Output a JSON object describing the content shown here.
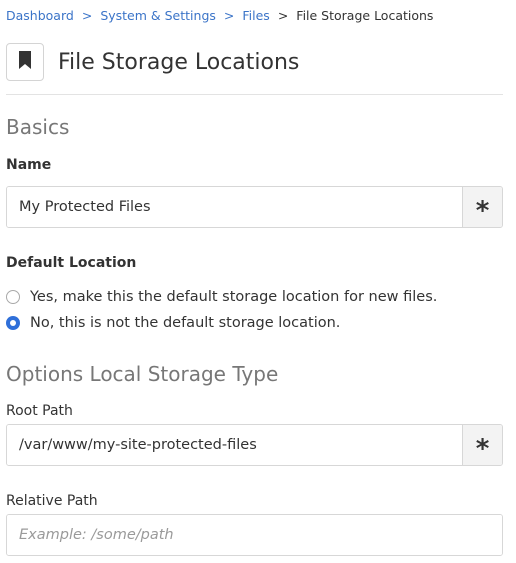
{
  "breadcrumb": {
    "items": [
      "Dashboard",
      "System & Settings",
      "Files"
    ],
    "separator": ">",
    "current": "File Storage Locations"
  },
  "header": {
    "icon": "bookmark-icon",
    "title": "File Storage Locations"
  },
  "basics": {
    "title": "Basics",
    "name_label": "Name",
    "name_value": "My Protected Files",
    "required_marker": "*",
    "default_location_label": "Default Location",
    "options": [
      {
        "label": "Yes, make this the default storage location for new files.",
        "checked": false
      },
      {
        "label": "No, this is not the default storage location.",
        "checked": true
      }
    ]
  },
  "local_storage": {
    "title": "Options Local Storage Type",
    "root_path_label": "Root Path",
    "root_path_value": "/var/www/my-site-protected-files",
    "required_marker": "*",
    "relative_path_label": "Relative Path",
    "relative_path_placeholder": "Example: /some/path",
    "relative_path_value": ""
  },
  "colors": {
    "link": "#3b74c8",
    "radio_checked": "#2f6fd9",
    "section_title": "#777777"
  }
}
